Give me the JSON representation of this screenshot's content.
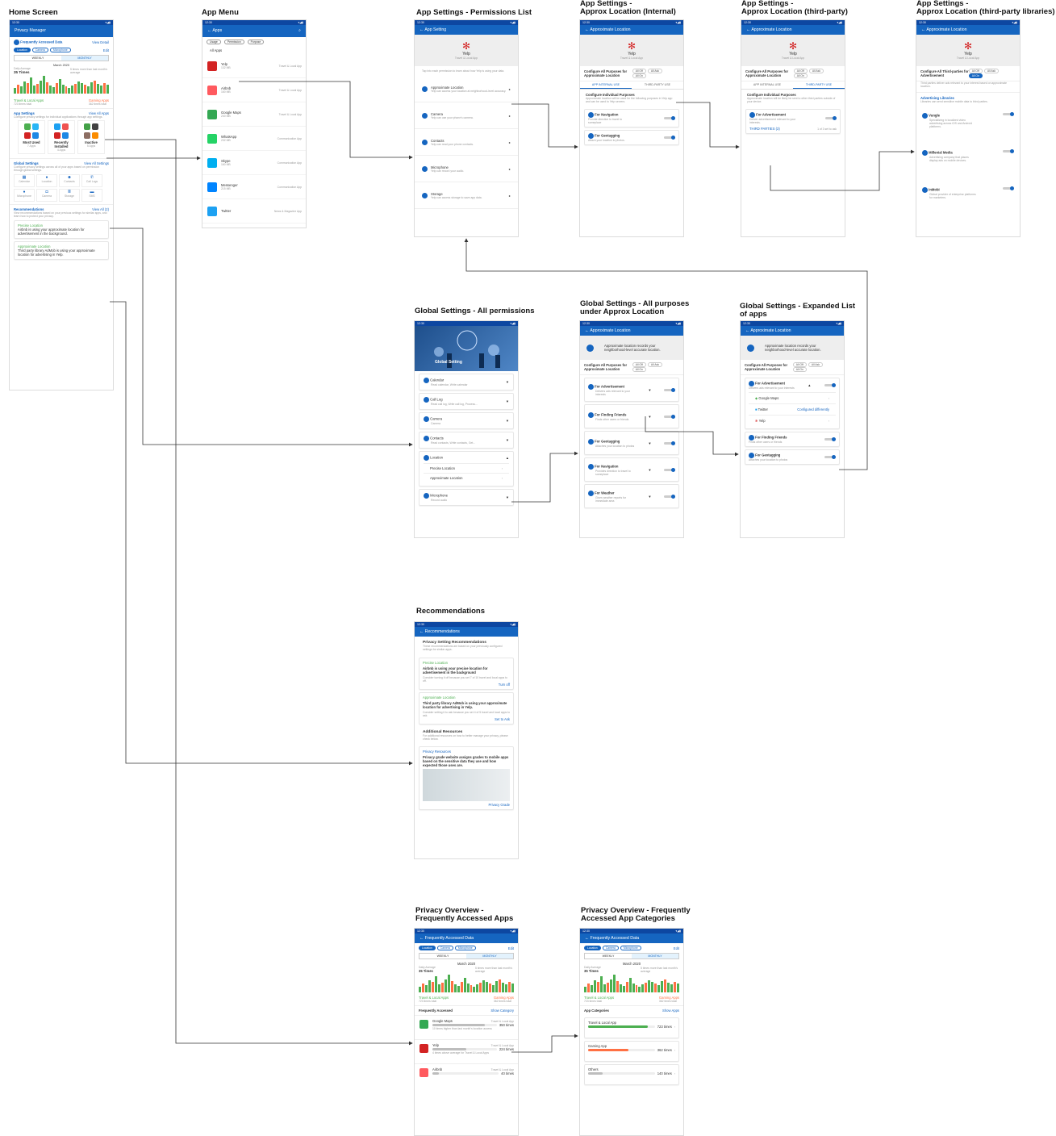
{
  "titles": {
    "home": "Home Screen",
    "menu": "App Menu",
    "perm": "App Settings - Permissions List",
    "internal": "App Settings -\nApprox Location (Internal)",
    "third": "App Settings -\nApprox Location (third-party)",
    "libs": "App Settings -\nApprox Location (third-party libraries)",
    "global_all": "Global Settings - All permissions",
    "global_purposes": "Global Settings - All purposes\nunder Approx Location",
    "global_expanded": "Global Settings - Expanded List\nof apps",
    "recs": "Recommendations",
    "overview_apps": "Privacy Overview -\nFrequently Accessed Apps",
    "overview_cats": "Privacy Overview - Frequently\nAccessed App Categories"
  },
  "time": "12:30",
  "home": {
    "appbar": "Privacy Manager",
    "fad_title": "Frequently Accessed Data",
    "view_detail": "View Detail",
    "chips": [
      "Location",
      "Camera",
      "Microphone"
    ],
    "edit": "Edit",
    "weekly": "WEEKLY",
    "monthly": "MONTHLY",
    "month": "March 2020",
    "daily_avg_label": "Daily Average",
    "daily_avg": "35 Times",
    "note": "5 times more than last month's average",
    "legend1": "Travel & Local Apps",
    "legend1_total": "723 times total",
    "legend2": "Gaming Apps",
    "legend2_total": "362 times total",
    "app_settings": "App Settings",
    "view_all_apps": "View All Apps",
    "app_settings_desc": "Configure privacy settings for individual applications through app settings.",
    "groups": [
      {
        "name": "Most Used",
        "sub": "7 Apps"
      },
      {
        "name": "Recently Installed",
        "sub": "4 Apps"
      },
      {
        "name": "Inactive",
        "sub": "5 Apps"
      }
    ],
    "global_settings": "Global Settings",
    "view_all_settings": "View All Settings",
    "global_desc": "Configure privacy settings across all of your apps based on permission through global settings.",
    "perms": [
      "Calendar",
      "Location",
      "Contacts",
      "Call Logs",
      "Microphone",
      "Camera",
      "Storage",
      "SMS"
    ],
    "recs": "Recommendations",
    "view_all_recs": "View All (2)",
    "recs_desc": "View recommendations based on your previous settings for similar apps, and learn how to protect your privacy.",
    "rec1_title": "Precise Location",
    "rec1_text": "Airbnb is using your approximate location for advertisement in the background.",
    "rec2_title": "Approximate Location",
    "rec2_text": "Third party library AdMob is using your approximate location for advertising in Yelp."
  },
  "menu": {
    "appbar": "Apps",
    "filters": [
      "Usage",
      "Permission",
      "Purpose"
    ],
    "all": "All Apps",
    "apps": [
      {
        "name": "Yelp",
        "size": "132 MB",
        "cat": "Travel & Local App"
      },
      {
        "name": "Airbnb",
        "size": "160 MB",
        "cat": "Travel & Local App"
      },
      {
        "name": "Google Maps",
        "size": "240 MB",
        "cat": "Travel & Local App"
      },
      {
        "name": "WhatsApp",
        "size": "232 MB",
        "cat": "Communication App"
      },
      {
        "name": "Skype",
        "size": "160 MB",
        "cat": "Communication App"
      },
      {
        "name": "Messenger",
        "size": "215 MB",
        "cat": "Communication App"
      },
      {
        "name": "Twitter",
        "size": "",
        "cat": "News & Magazine App"
      }
    ]
  },
  "perm": {
    "appbar": "App Setting",
    "app": "Yelp",
    "cat": "Travel & Local App",
    "intro": "Tap into each permission to learn about how Yelp is using your data.",
    "items": [
      {
        "name": "Approximate Location",
        "desc": "Yelp can access your location at neighborhood-level accuracy."
      },
      {
        "name": "Camera",
        "desc": "Yelp can use your phone's camera."
      },
      {
        "name": "Contacts",
        "desc": "Yelp can read your phone contacts."
      },
      {
        "name": "Microphone",
        "desc": "Yelp can record your audio."
      },
      {
        "name": "Storage",
        "desc": "Yelp can access storage to save app data."
      }
    ]
  },
  "loc": {
    "appbar": "Approximate Location",
    "cfg_all": "Configure All Purposes for Approximate Location",
    "all_off": "All Off",
    "all_ask": "All Ask",
    "all_on": "All On",
    "tab1": "APP INTERNAL USE",
    "tab2": "THIRD-PARTY USE",
    "cfg_ind": "Configure Individual Purposes",
    "ind_desc": "Approximate location will be used for the following purposes in Yelp app and can be used to Yelp servers.",
    "nav": "For Navigation",
    "nav_desc": "Provide direction to travel to someplace",
    "geo": "For Geotagging",
    "geo_desc": "Attach your location to photos.",
    "ad": "For Advertisement",
    "ad_desc": "Deliver advertisement relevant to your interests.",
    "third_desc": "Approximate location will be likely be sent to other third parties outside of your device.",
    "third_parties": "THIRD PARTIES (3)",
    "third_count": "1 of 3 set to ask",
    "off": "Off",
    "ask": "Ask",
    "on": "On"
  },
  "libs": {
    "cfg_all": "Configure All Third-parties for Advertisement",
    "desc": "Third parties deliver ads relevant to your interest based on approximate location.",
    "title": "Advertising Libraries",
    "sub": "Libraries can send sensitive mobile data to third parties.",
    "items": [
      {
        "name": "Vungle",
        "desc": "Specializing in localized video advertising across iOS and Android platforms."
      },
      {
        "name": "Millenial Media",
        "desc": "Advertising company that places display ads on mobile devices."
      },
      {
        "name": "InMobi",
        "desc": "Global provider of enterprise platforms for marketers."
      }
    ]
  },
  "global": {
    "banner": "Global Setting",
    "perms": [
      {
        "name": "Calendar",
        "desc": "Read calendar, Write calendar"
      },
      {
        "name": "Call Log",
        "desc": "Read call log, Write call log, Process..."
      },
      {
        "name": "Camera",
        "desc": "Camera"
      },
      {
        "name": "Contacts",
        "desc": "Read contacts, Write contacts, Get..."
      },
      {
        "name": "Location",
        "desc": ""
      },
      {
        "name": "Microphone",
        "desc": "Record audio"
      }
    ],
    "precise": "Precise Location",
    "approx": "Approximate Location"
  },
  "gp": {
    "intro": "Approximate location records your neighborhood-level accurate location.",
    "purposes": [
      {
        "name": "For Advertisement",
        "desc": "Delivers ads relevant to your interests"
      },
      {
        "name": "For Finding Friends",
        "desc": "Finds other users or friends"
      },
      {
        "name": "For Geotagging",
        "desc": "Attaches your location to photos"
      },
      {
        "name": "For Navigation",
        "desc": "Provides direction to travel to someplace"
      },
      {
        "name": "For Weather",
        "desc": "Gives weather reports for immediate area"
      }
    ],
    "apps": [
      "Google Maps",
      "Twitter",
      "Yelp"
    ],
    "configure_diff": "Configured differently"
  },
  "recs": {
    "appbar": "Recommendations",
    "title": "Privacy Setting Recommendations",
    "desc": "These recommendations are based on your previously configured settings for similar apps.",
    "r1_type": "Precise Location",
    "r1_text": "Airbnb is using your precise location for advertisement in the background",
    "r1_hint": "Consider turning it off because you set 7 of 10 travel and local apps to off.",
    "r1_btn": "Turn off",
    "r2_type": "Approximate Location",
    "r2_text": "Third party library AdMob is using your approximate location for advertising in Yelp.",
    "r2_hint": "Consider setting it to ask because you set 4 of 5 travel and local apps to ask.",
    "r2_btn": "Set to Ask",
    "add_title": "Additional Resources",
    "add_desc": "For additional resources on how to better manage your privacy, please check below.",
    "pg_label": "Privacy Resources",
    "pg_text": "Privacy grade website assigns grades to mobile apps based on the sensitive data they use and how expected those uses are.",
    "pg_link": "Privacy Grade"
  },
  "ov": {
    "appbar": "Frequently Accessed Data",
    "fa": "Frequently Accessed",
    "show_cat": "Show Category",
    "apps": [
      {
        "name": "Google Maps",
        "cat": "Travel & Local App",
        "count": "350 times",
        "note": "10 times higher than last month's location access",
        "pct": 0.82
      },
      {
        "name": "Yelp",
        "cat": "Travel & Local App",
        "count": "224 times",
        "note": "4 times above average for Travel & Local Apps",
        "pct": 0.52
      },
      {
        "name": "Airbnb",
        "cat": "Travel & Local App",
        "count": "40 times",
        "note": "",
        "pct": 0.1
      }
    ],
    "app_cats": "App Categories",
    "show_apps": "Show Apps",
    "cats": [
      {
        "name": "Travel & Local App",
        "count": "723 times",
        "pct": 0.9
      },
      {
        "name": "Gaming App",
        "count": "362 times",
        "pct": 0.6
      },
      {
        "name": "Others",
        "count": "140 times",
        "pct": 0.22
      }
    ]
  },
  "colors": {
    "primary": "#1565c0",
    "green": "#4caf50",
    "orange": "#ff7043",
    "red": "#d32323"
  }
}
